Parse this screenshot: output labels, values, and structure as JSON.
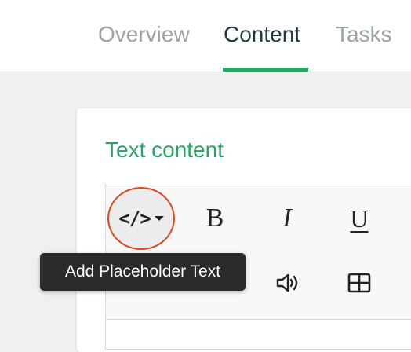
{
  "tabs": [
    {
      "label": "Overview",
      "active": false
    },
    {
      "label": "Content",
      "active": true
    },
    {
      "label": "Tasks",
      "active": false
    }
  ],
  "section": {
    "title": "Text content"
  },
  "toolbar": {
    "placeholder_icon": "</>",
    "bold_label": "B",
    "italic_label": "I",
    "underline_label": "U",
    "icons": [
      "code-icon",
      "bold-icon",
      "italic-icon",
      "underline-icon",
      "image-icon",
      "media-icon",
      "audio-icon",
      "table-icon"
    ]
  },
  "tooltip": {
    "text": "Add Placeholder Text"
  },
  "colors": {
    "accent": "#2aa463",
    "highlight_ring": "#e0471d",
    "tooltip_bg": "#2a2a2a",
    "active_tab": "#1f3a3d",
    "inactive_tab": "#9aa3a8"
  }
}
